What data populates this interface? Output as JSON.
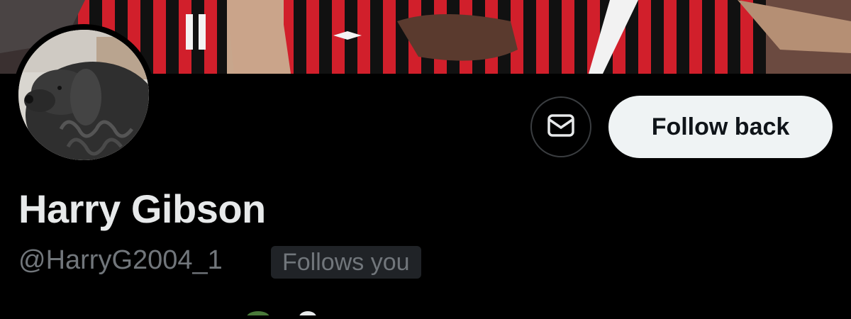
{
  "profile": {
    "name": "Harry Gibson",
    "handle": "@HarryG2004_1",
    "follows_you_badge": "Follows you"
  },
  "actions": {
    "follow_label": "Follow back",
    "message_icon": "envelope-icon"
  },
  "colors": {
    "background": "#000000",
    "follow_button_bg": "#eff3f4",
    "name_text": "#e7e9ea",
    "secondary_text": "#71767b",
    "badge_bg": "#202327",
    "kit_red": "#d11f2b",
    "kit_black": "#111111"
  }
}
